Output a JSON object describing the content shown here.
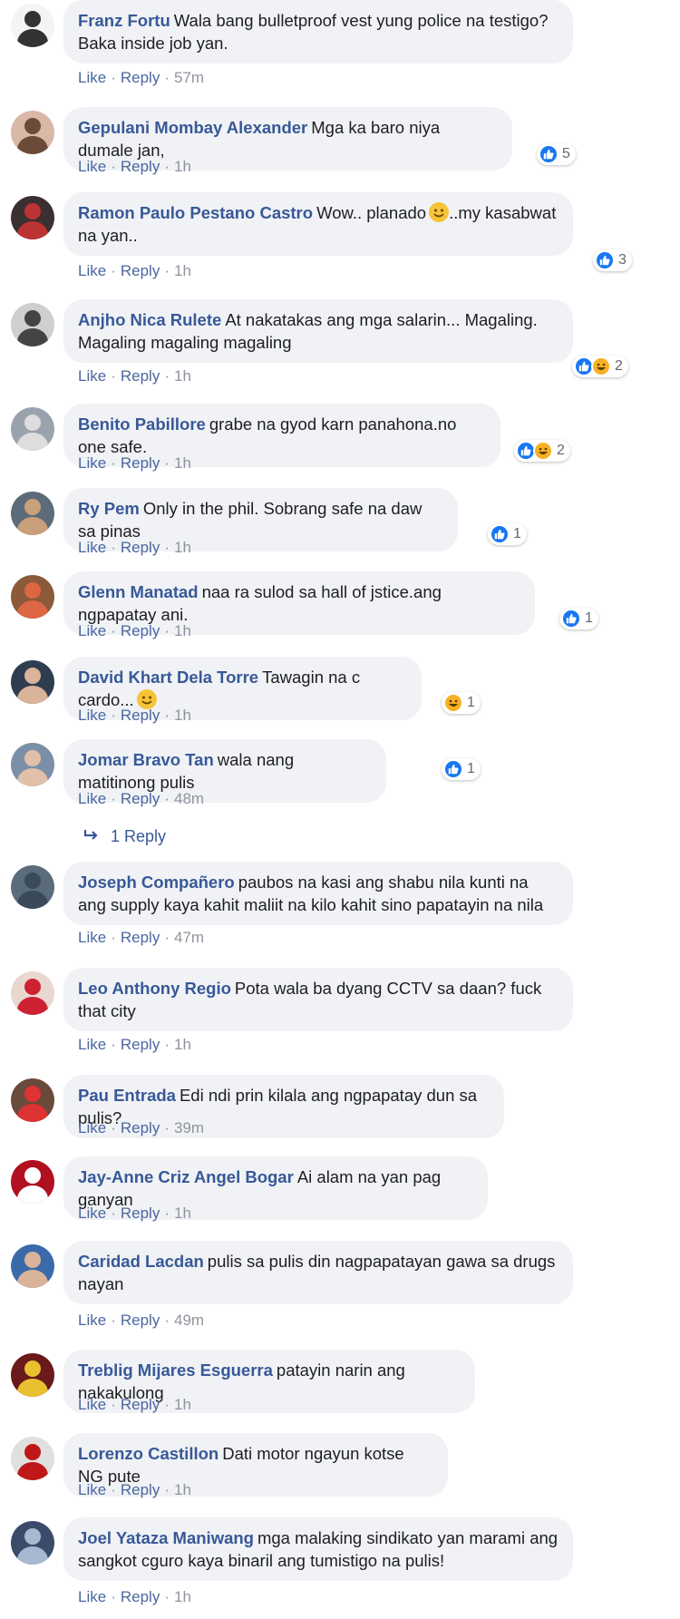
{
  "actions": {
    "like": "Like",
    "reply": "Reply"
  },
  "colors": {
    "author": "#385898",
    "bubble": "#f0f2f5",
    "link": "#4b67a1",
    "meta": "#90949c",
    "like_blue": "#1877f2",
    "haha_yellow": "#f7b125"
  },
  "comments": [
    {
      "author": "Franz Fortu",
      "text": "Wala bang bulletproof vest yung police na testigo? Baka inside job yan.",
      "time": "57m",
      "reactions": null
    },
    {
      "author": "Gepulani Mombay Alexander",
      "text": "Mga ka baro niya dumale jan,",
      "time": "1h",
      "reactions": {
        "types": [
          "like"
        ],
        "count": "5"
      }
    },
    {
      "author": "Ramon Paulo Pestano Castro",
      "text": "Wow.. planado",
      "text_after": "..my kasabwat na yan..",
      "inline_emoji": "grinning-face-emoji",
      "time": "1h",
      "reactions": {
        "types": [
          "like"
        ],
        "count": "3"
      }
    },
    {
      "author": "Anjho Nica Rulete",
      "text": "At nakatakas ang mga salarin... Magaling. Magaling magaling magaling",
      "time": "1h",
      "reactions": {
        "types": [
          "like",
          "haha"
        ],
        "count": "2"
      }
    },
    {
      "author": "Benito Pabillore",
      "text": "grabe na gyod karn panahona.no one safe.",
      "time": "1h",
      "reactions": {
        "types": [
          "like",
          "haha"
        ],
        "count": "2"
      }
    },
    {
      "author": "Ry Pem",
      "text": "Only in the phil. Sobrang safe na daw sa pinas",
      "time": "1h",
      "reactions": {
        "types": [
          "like"
        ],
        "count": "1"
      }
    },
    {
      "author": "Glenn Manatad",
      "text": "naa ra sulod sa hall of jstice.ang ngpapatay ani.",
      "time": "1h",
      "reactions": {
        "types": [
          "like"
        ],
        "count": "1"
      }
    },
    {
      "author": "David Khart Dela Torre",
      "text": "Tawagin na c cardo...",
      "inline_emoji": "thinking-face-emoji",
      "time": "1h",
      "reactions": {
        "types": [
          "haha"
        ],
        "count": "1"
      }
    },
    {
      "author": "Jomar Bravo Tan",
      "text": "wala nang matitinong pulis",
      "time": "48m",
      "reactions": {
        "types": [
          "like"
        ],
        "count": "1"
      }
    },
    {
      "author": "Joseph Compañero",
      "text": "paubos na kasi ang shabu nila kunti na ang supply kaya kahit maliit na kilo kahit sino papatayin na nila",
      "time": "47m",
      "reactions": null
    },
    {
      "author": "Leo Anthony Regio",
      "text": "Pota wala ba dyang CCTV sa daan? fuck that city",
      "time": "1h",
      "reactions": null
    },
    {
      "author": "Pau Entrada",
      "text": "Edi ndi prin kilala ang ngpapatay dun sa pulis?",
      "time": "39m",
      "reactions": null
    },
    {
      "author": "Jay-Anne Criz Angel Bogar",
      "text": "Ai alam na yan pag ganyan",
      "time": "1h",
      "reactions": null
    },
    {
      "author": "Caridad Lacdan",
      "text": "pulis sa pulis din nagpapatayan gawa sa drugs nayan",
      "time": "49m",
      "reactions": null
    },
    {
      "author": "Treblig Mijares Esguerra",
      "text": "patayin narin ang nakakulong",
      "time": "1h",
      "reactions": null
    },
    {
      "author": "Lorenzo Castillon",
      "text": "Dati motor ngayun kotse NG pute",
      "time": "1h",
      "reactions": null
    },
    {
      "author": "Joel Yataza Maniwang",
      "text": "mga malaking sindikato yan marami ang sangkot cguro kaya binaril ang tumistigo na pulis!",
      "time": "1h",
      "reactions": null
    }
  ],
  "replies_link": {
    "label": "1 Reply",
    "icon": "reply-arrow-icon"
  }
}
